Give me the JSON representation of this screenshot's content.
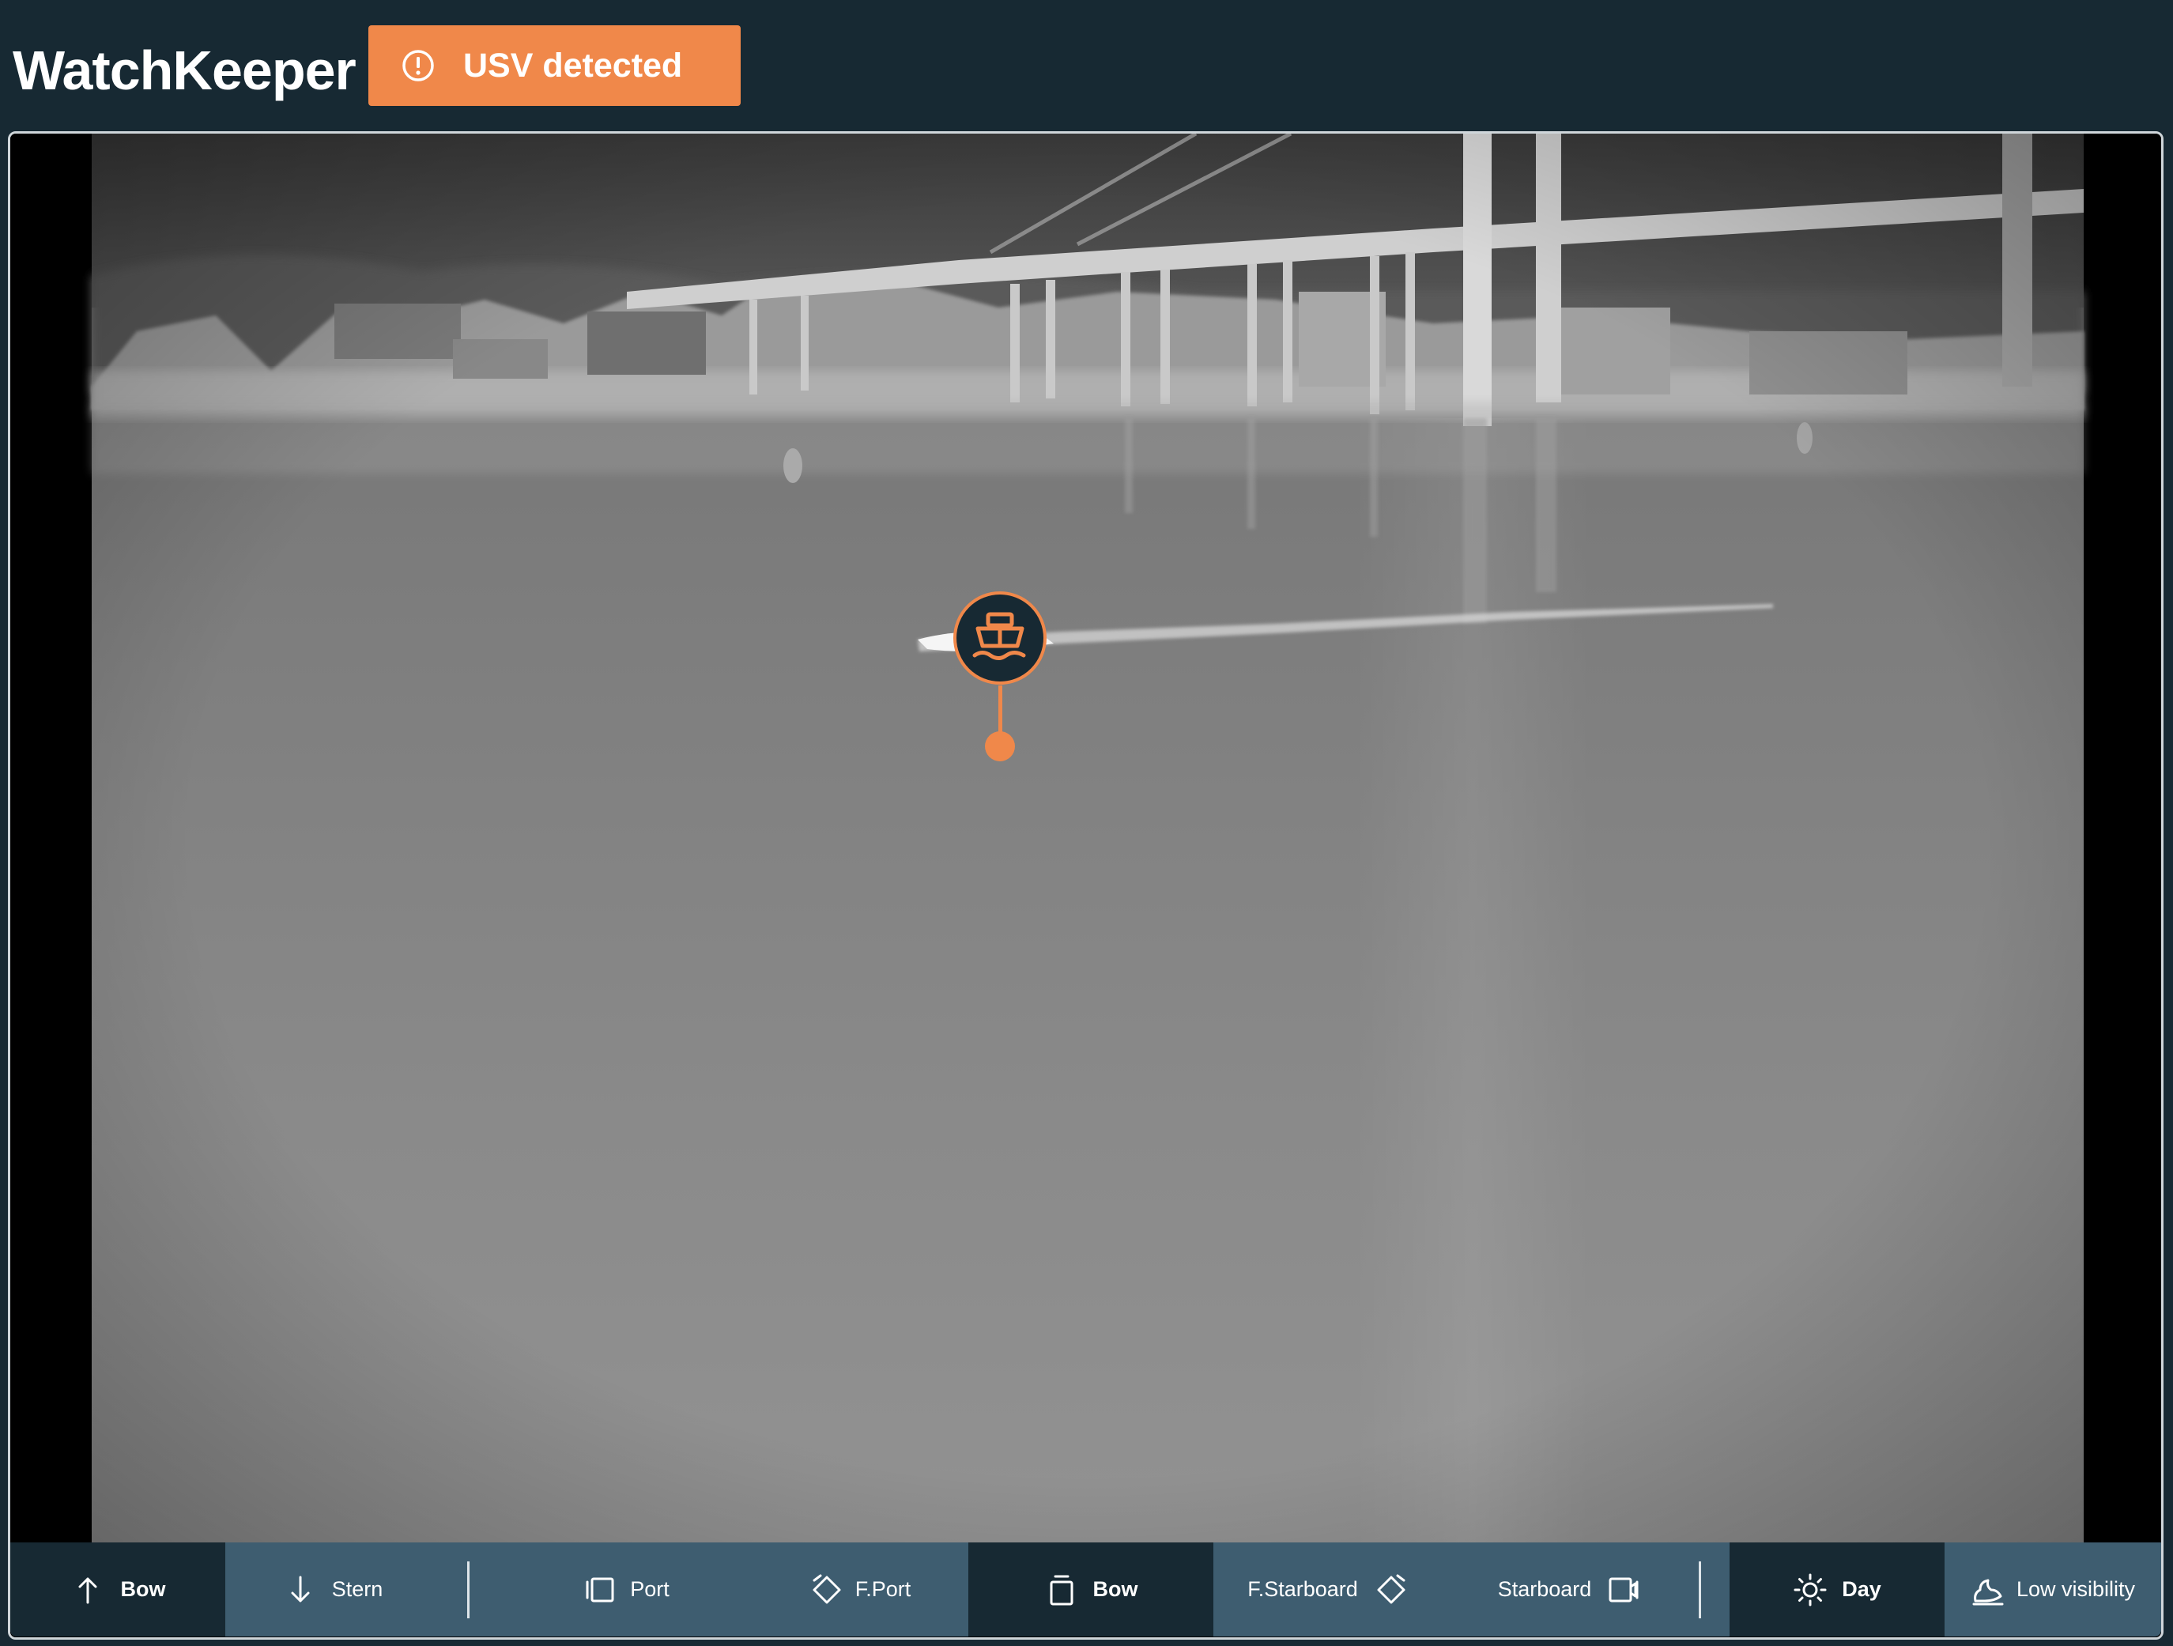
{
  "app": {
    "title": "WatchKeeper"
  },
  "alert": {
    "text": "USV detected",
    "icon": "alert-circle-icon",
    "color": "#f0884a"
  },
  "feed": {
    "mode": "thermal",
    "marker": {
      "icon": "ship-icon",
      "color": "#f0884a"
    }
  },
  "toolbar": {
    "camera_buttons": [
      {
        "label": "Bow",
        "icon": "arrow-up-icon",
        "active": true
      },
      {
        "label": "Stern",
        "icon": "arrow-down-icon",
        "active": false
      }
    ],
    "view_buttons": [
      {
        "label": "Port",
        "icon": "port-view-icon",
        "active": false
      },
      {
        "label": "F.Port",
        "icon": "forward-port-icon",
        "active": false
      },
      {
        "label": "Bow",
        "icon": "bow-view-icon",
        "active": true
      },
      {
        "label": "F.Starboard",
        "icon": "forward-starboard-icon",
        "active": false
      },
      {
        "label": "Starboard",
        "icon": "starboard-view-icon",
        "active": false
      }
    ],
    "mode_buttons": [
      {
        "label": "Day",
        "icon": "sun-icon",
        "active": true
      },
      {
        "label": "Low visibility",
        "icon": "low-visibility-icon",
        "active": false
      }
    ]
  },
  "colors": {
    "background": "#172933",
    "toolbar": "#3e5d70",
    "accent": "#f0884a"
  }
}
